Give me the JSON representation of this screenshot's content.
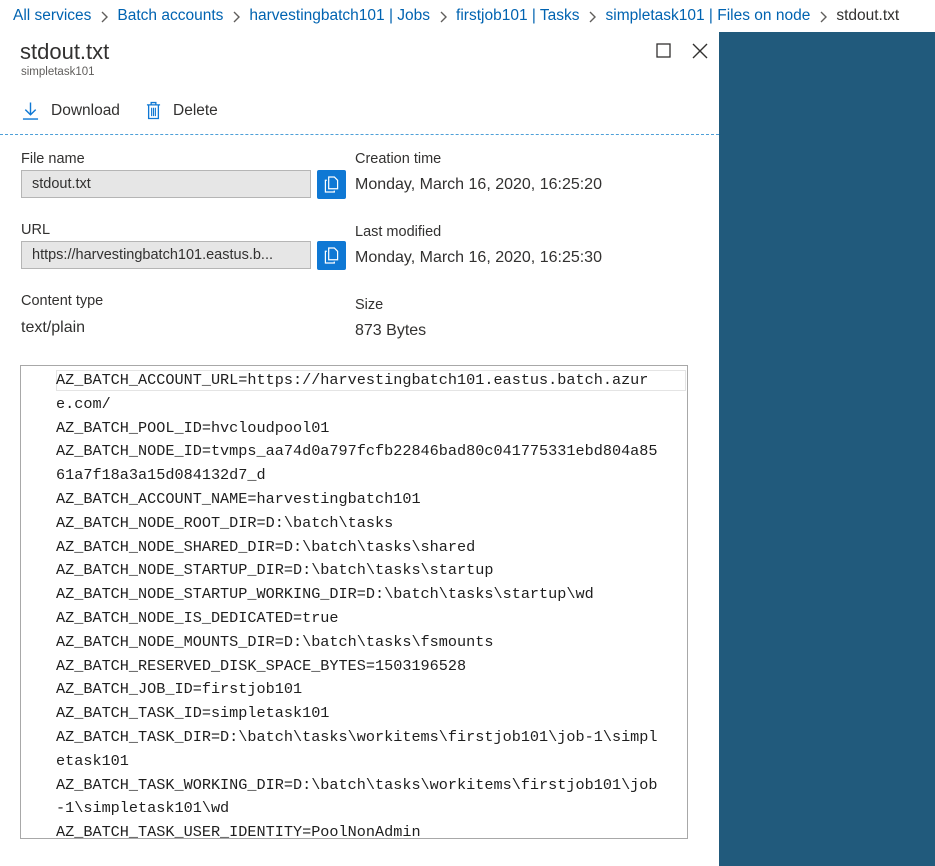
{
  "breadcrumb": {
    "items": [
      "All services",
      "Batch accounts",
      "harvestingbatch101 | Jobs",
      "firstjob101 | Tasks",
      "simpletask101 | Files on node"
    ],
    "current": "stdout.txt"
  },
  "blade": {
    "title": "stdout.txt",
    "subtitle": "simpletask101"
  },
  "commands": {
    "download_label": "Download",
    "delete_label": "Delete"
  },
  "properties": {
    "file_name_label": "File name",
    "file_name_value": "stdout.txt",
    "url_label": "URL",
    "url_value": "https://harvestingbatch101.eastus.b...",
    "content_type_label": "Content type",
    "content_type_value": "text/plain",
    "creation_time_label": "Creation time",
    "creation_time_value": "Monday, March 16, 2020, 16:25:20",
    "last_modified_label": "Last modified",
    "last_modified_value": "Monday, March 16, 2020, 16:25:30",
    "size_label": "Size",
    "size_value": "873 Bytes"
  },
  "file_content": "AZ_BATCH_ACCOUNT_URL=https://harvestingbatch101.eastus.batch.azure.com/\nAZ_BATCH_POOL_ID=hvcloudpool01\nAZ_BATCH_NODE_ID=tvmps_aa74d0a797fcfb22846bad80c041775331ebd804a8561a7f18a3a15d084132d7_d\nAZ_BATCH_ACCOUNT_NAME=harvestingbatch101\nAZ_BATCH_NODE_ROOT_DIR=D:\\batch\\tasks\nAZ_BATCH_NODE_SHARED_DIR=D:\\batch\\tasks\\shared\nAZ_BATCH_NODE_STARTUP_DIR=D:\\batch\\tasks\\startup\nAZ_BATCH_NODE_STARTUP_WORKING_DIR=D:\\batch\\tasks\\startup\\wd\nAZ_BATCH_NODE_IS_DEDICATED=true\nAZ_BATCH_NODE_MOUNTS_DIR=D:\\batch\\tasks\\fsmounts\nAZ_BATCH_RESERVED_DISK_SPACE_BYTES=1503196528\nAZ_BATCH_JOB_ID=firstjob101\nAZ_BATCH_TASK_ID=simpletask101\nAZ_BATCH_TASK_DIR=D:\\batch\\tasks\\workitems\\firstjob101\\job-1\\simpletask101\nAZ_BATCH_TASK_WORKING_DIR=D:\\batch\\tasks\\workitems\\firstjob101\\job-1\\simpletask101\\wd\nAZ_BATCH_TASK_USER_IDENTITY=PoolNonAdmin",
  "colors": {
    "accent": "#0f78d4",
    "link": "#0063b1",
    "side_panel": "#215a7c"
  },
  "icons": [
    "chevron-right-icon",
    "maximize-icon",
    "close-icon",
    "download-icon",
    "trash-icon",
    "copy-icon"
  ]
}
